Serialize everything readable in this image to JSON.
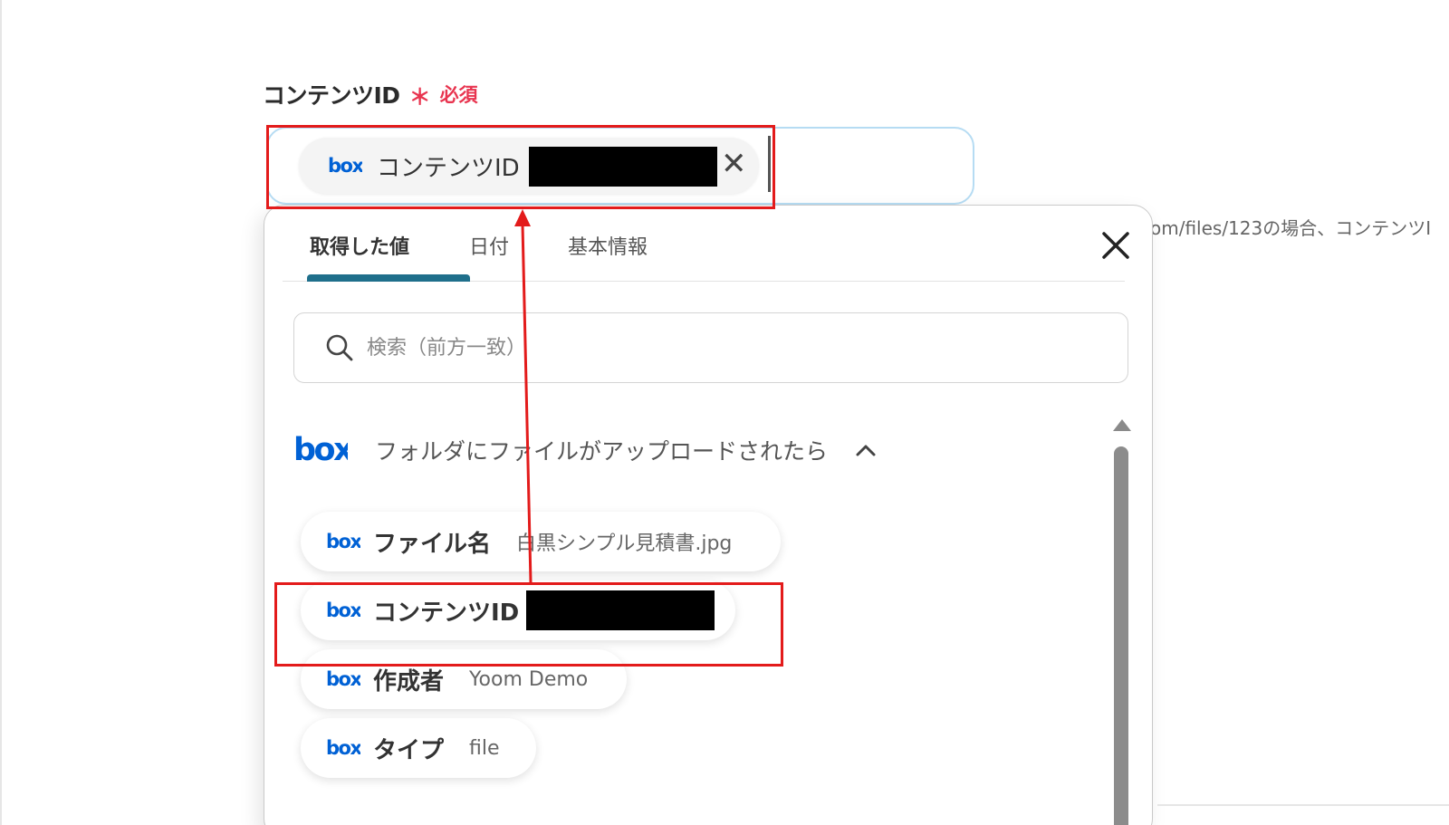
{
  "field": {
    "label": "コンテンツID",
    "asterisk": "＊",
    "required": "必須",
    "chip_label": "コンテンツID",
    "hint": "om/files/123の場合、コンテンツI"
  },
  "popover": {
    "tabs": [
      "取得した値",
      "日付",
      "基本情報"
    ],
    "search_placeholder": "検索（前方一致）",
    "section_title": "フォルダにファイルがアップロードされたら",
    "items": [
      {
        "name": "ファイル名",
        "value": "白黒シンプル見積書.jpg"
      },
      {
        "name": "コンテンツID",
        "value": ""
      },
      {
        "name": "作成者",
        "value": "Yoom Demo"
      },
      {
        "name": "タイプ",
        "value": "file"
      }
    ]
  },
  "icons": {
    "logo": "box-logo",
    "search": "search-icon",
    "close": "close-icon",
    "chevron": "chevron-up-icon"
  },
  "colors": {
    "box_blue": "#0061d5",
    "accent": "#1f6f8b",
    "required": "#e8344f",
    "highlight": "#e31b1b"
  }
}
